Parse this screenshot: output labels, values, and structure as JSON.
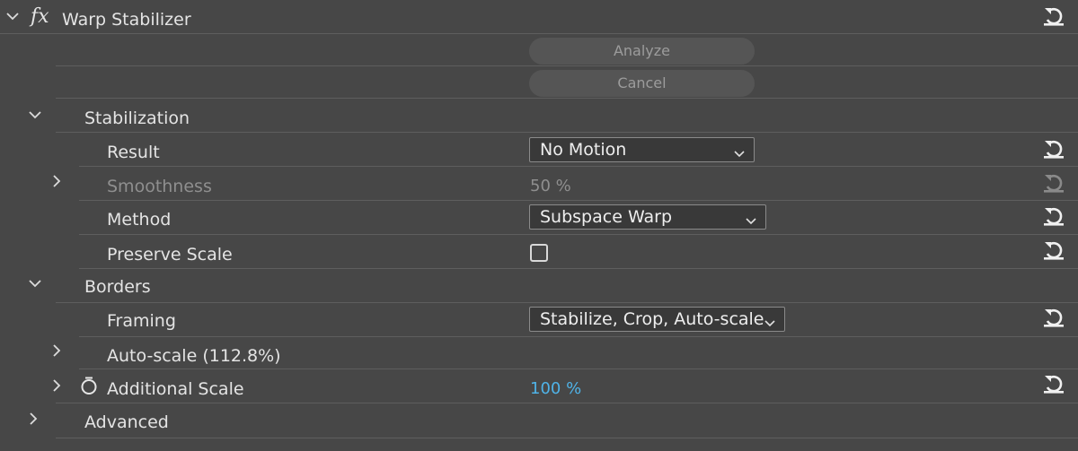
{
  "effect": {
    "fx_symbol": "fx",
    "title": "Warp Stabilizer"
  },
  "buttons": {
    "analyze": "Analyze",
    "cancel": "Cancel"
  },
  "stabilization": {
    "label": "Stabilization",
    "result": {
      "label": "Result",
      "value": "No Motion"
    },
    "smoothness": {
      "label": "Smoothness",
      "value": "50 %"
    },
    "method": {
      "label": "Method",
      "value": "Subspace Warp"
    },
    "preserve_scale": {
      "label": "Preserve Scale",
      "checked": false
    }
  },
  "borders": {
    "label": "Borders",
    "framing": {
      "label": "Framing",
      "value": "Stabilize, Crop, Auto-scale"
    },
    "auto_scale": {
      "label": "Auto-scale (112.8%)"
    },
    "additional_scale": {
      "label": "Additional Scale",
      "value": "100 %"
    }
  },
  "advanced": {
    "label": "Advanced"
  },
  "colors": {
    "panel_bg": "#474747",
    "divider": "#5e5e5e",
    "link_value": "#4fb3e8",
    "dim_text": "#8f8f8f"
  }
}
